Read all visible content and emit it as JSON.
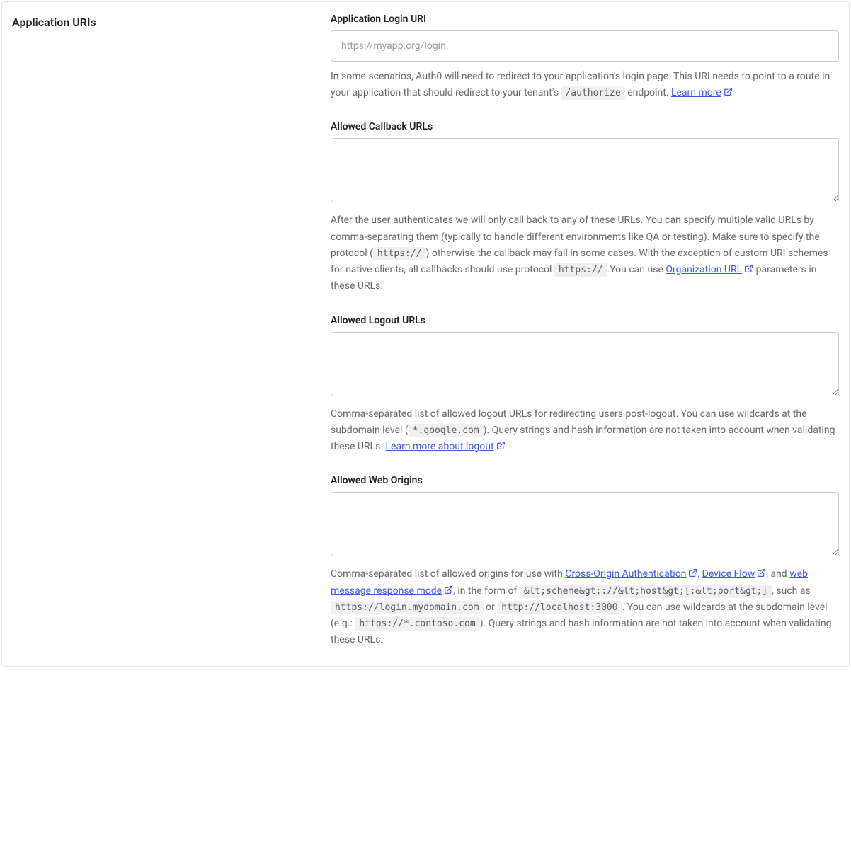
{
  "section": {
    "heading": "Application URIs"
  },
  "loginUri": {
    "label": "Application Login URI",
    "placeholder": "https://myapp.org/login",
    "value": "",
    "help1": "In some scenarios, Auth0 will need to redirect to your application's login page. This URI needs to point to a route in your application that should redirect to your tenant's ",
    "code1": "/authorize",
    "help2": " endpoint. ",
    "learnMore": "Learn more"
  },
  "callbackUrls": {
    "label": "Allowed Callback URLs",
    "value": "",
    "help1": "After the user authenticates we will only call back to any of these URLs. You can specify multiple valid URLs by comma-separating them (typically to handle different environments like QA or testing). Make sure to specify the protocol (",
    "code1": "https://",
    "help2": ") otherwise the callback may fail in some cases. With the exception of custom URI schemes for native clients, all callbacks should use protocol ",
    "code2": "https://",
    "help3": ".You can use ",
    "orgUrlLink": "Organization URL",
    "help4": " parameters in these URLs."
  },
  "logoutUrls": {
    "label": "Allowed Logout URLs",
    "value": "",
    "help1": "Comma-separated list of allowed logout URLs for redirecting users post-logout. You can use wildcards at the subdomain level (",
    "code1": "*.google.com",
    "help2": "). Query strings and hash information are not taken into account when validating these URLs. ",
    "learnMore": "Learn more about logout"
  },
  "webOrigins": {
    "label": "Allowed Web Origins",
    "value": "",
    "help1": "Comma-separated list of allowed origins for use with ",
    "link1": "Cross-Origin Authentication",
    "help2": ", ",
    "link2": "Device Flow",
    "help3": ", and ",
    "link3": "web message response mode",
    "help4": ", in the form of ",
    "code1": "&lt;scheme&gt;://&lt;host&gt;[:&lt;port&gt;]",
    "help5": ", such as ",
    "code2": "https://login.mydomain.com",
    "help6": " or ",
    "code3": "http://localhost:3000",
    "help7": ". You can use wildcards at the subdomain level (e.g.: ",
    "code4": "https://*.contoso.com",
    "help8": "). Query strings and hash information are not taken into account when validating these URLs."
  }
}
